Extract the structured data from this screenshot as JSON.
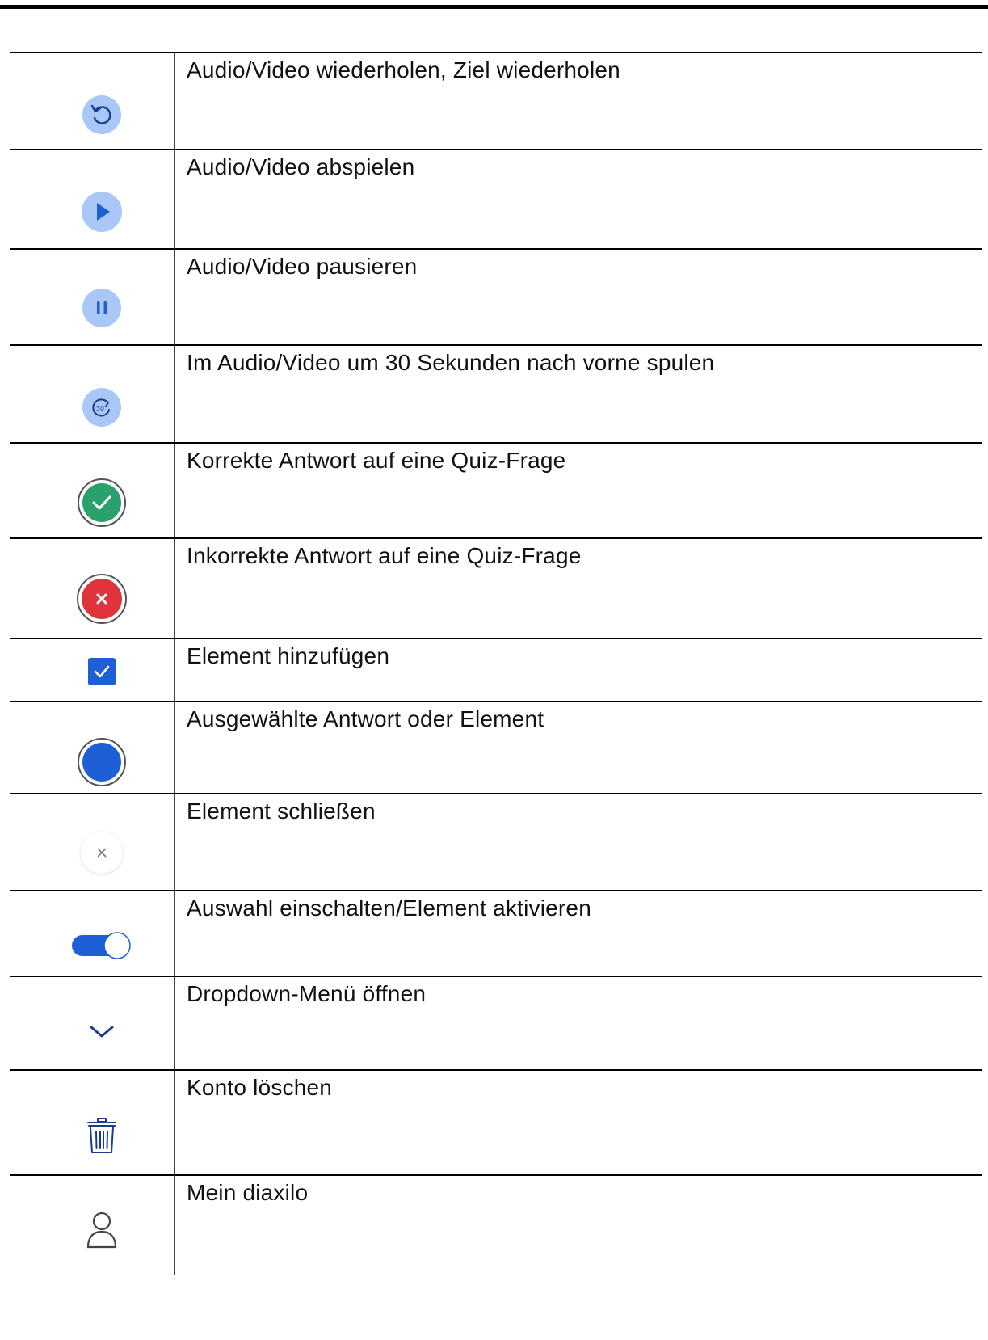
{
  "colors": {
    "light_blue_circle": "#a9c8f7",
    "primary_blue": "#1f5fd6",
    "correct_green": "#2aa06b",
    "incorrect_red": "#e0343c",
    "icon_navy": "#1a3e8c"
  },
  "rows": [
    {
      "icon": "replay-icon",
      "label": "Audio/Video wiederholen, Ziel wiederholen"
    },
    {
      "icon": "play-icon",
      "label": "Audio/Video abspielen"
    },
    {
      "icon": "pause-icon",
      "label": "Audio/Video pausieren"
    },
    {
      "icon": "forward-30-icon",
      "icon_text": "30",
      "label": "Im Audio/Video um 30 Sekunden nach vorne spulen"
    },
    {
      "icon": "correct-check-icon",
      "label": "Korrekte Antwort auf eine Quiz-Frage"
    },
    {
      "icon": "incorrect-cross-icon",
      "label": "Inkorrekte Antwort auf eine Quiz-Frage"
    },
    {
      "icon": "checkbox-checked-icon",
      "label": "Element hinzufügen"
    },
    {
      "icon": "radio-selected-icon",
      "label": "Ausgewählte Antwort oder Element"
    },
    {
      "icon": "close-icon",
      "label": "Element schließen"
    },
    {
      "icon": "toggle-on-icon",
      "label": "Auswahl einschalten/Element aktivieren"
    },
    {
      "icon": "chevron-down-icon",
      "label": "Dropdown-Menü öffnen"
    },
    {
      "icon": "trash-icon",
      "label": "Konto löschen"
    },
    {
      "icon": "user-icon",
      "label": "Mein diaxilo"
    }
  ]
}
